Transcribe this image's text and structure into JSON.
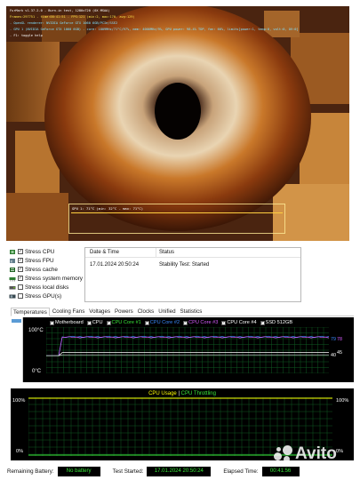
{
  "furmark": {
    "title_line": "FurMark v1.37.2.0 - Burn-in test, 1280x720 (0X MSAA)",
    "frames_line": "Frames:297751 - time:00:41:51 - FPS:121 (min:2, max:170, avg:129)",
    "opengl_line": "- OpenGL renderer: NVIDIA GeForce GTX 1060 6GB/PCIe/SSE2",
    "gpu_line": "- GPU 1 (NVIDIA GeForce GTX 1060 6GB) - core: 1809MHz/71°C/97%, mem: 4006MHz/9%, GPU power: 98.4% TDP, fan: 66%, limits[power:1, temp:0, volt:0, OV:0]",
    "help_line": "- F1: toggle help",
    "gpu_graph_label": "GPU 1: 71°C (min: 32°C - max: 71°C)"
  },
  "stress_options": [
    {
      "label": "Stress CPU",
      "checked": true,
      "icon": "cpu-icon"
    },
    {
      "label": "Stress FPU",
      "checked": true,
      "icon": "fpu-icon"
    },
    {
      "label": "Stress cache",
      "checked": true,
      "icon": "cache-icon"
    },
    {
      "label": "Stress system memory",
      "checked": true,
      "icon": "memory-icon"
    },
    {
      "label": "Stress local disks",
      "checked": false,
      "icon": "disk-icon"
    },
    {
      "label": "Stress GPU(s)",
      "checked": false,
      "icon": "gpu-icon"
    }
  ],
  "log": {
    "headers": {
      "date": "Date & Time",
      "status": "Status"
    },
    "rows": [
      {
        "date": "17.01.2024 20:50:24",
        "status": "Stability Test: Started"
      }
    ]
  },
  "tabs": [
    "Temperatures",
    "Cooling Fans",
    "Voltages",
    "Powers",
    "Clocks",
    "Unified",
    "Statistics"
  ],
  "active_tab": "Temperatures",
  "temp_chart": {
    "top_label": "100°C",
    "bottom_label": "0°C",
    "legend": [
      {
        "label": "Motherboard",
        "color": "#ffffff"
      },
      {
        "label": "CPU",
        "color": "#ffffff"
      },
      {
        "label": "CPU Core #1",
        "color": "#39e639"
      },
      {
        "label": "CPU Core #2",
        "color": "#3b8bff"
      },
      {
        "label": "CPU Core #3",
        "color": "#d75cff"
      },
      {
        "label": "CPU Core #4",
        "color": "#ffffff"
      },
      {
        "label": "SSD 512GB",
        "color": "#ffffff"
      }
    ],
    "value_labels": [
      {
        "text": "79",
        "color": "#3b8bff"
      },
      {
        "text": "78",
        "color": "#d75cff"
      },
      {
        "text": "45",
        "color": "#ffffff"
      },
      {
        "text": "40",
        "color": "#ffffff"
      }
    ]
  },
  "cpu_chart": {
    "title_usage": "CPU Usage",
    "title_sep": "|",
    "title_throttle": "CPU Throttling",
    "usage_color": "#ffff00",
    "throttle_color": "#39e639",
    "tick_top_left": "100%",
    "tick_bottom_left": "0%",
    "tick_top_right": "100%",
    "tick_bottom_right": "0%"
  },
  "status": {
    "battery_label": "Remaining Battery:",
    "battery_value": "No battery",
    "started_label": "Test Started:",
    "started_value": "17.01.2024 20:50:24",
    "elapsed_label": "Elapsed Time:",
    "elapsed_value": "00:41:56"
  },
  "watermark": "Avito",
  "chart_data": [
    {
      "type": "line",
      "title": "",
      "ylim": [
        0,
        100
      ],
      "series": [
        {
          "name": "CPU Core #2",
          "y": [
            79
          ]
        },
        {
          "name": "CPU Core #3",
          "y": [
            78
          ]
        },
        {
          "name": "Motherboard",
          "y": [
            45
          ]
        },
        {
          "name": "SSD 512GB",
          "y": [
            40
          ]
        }
      ]
    },
    {
      "type": "line",
      "title": "CPU Usage | CPU Throttling",
      "ylim": [
        0,
        100
      ],
      "series": [
        {
          "name": "CPU Usage",
          "y": [
            100
          ]
        },
        {
          "name": "CPU Throttling",
          "y": [
            0
          ]
        }
      ]
    }
  ]
}
